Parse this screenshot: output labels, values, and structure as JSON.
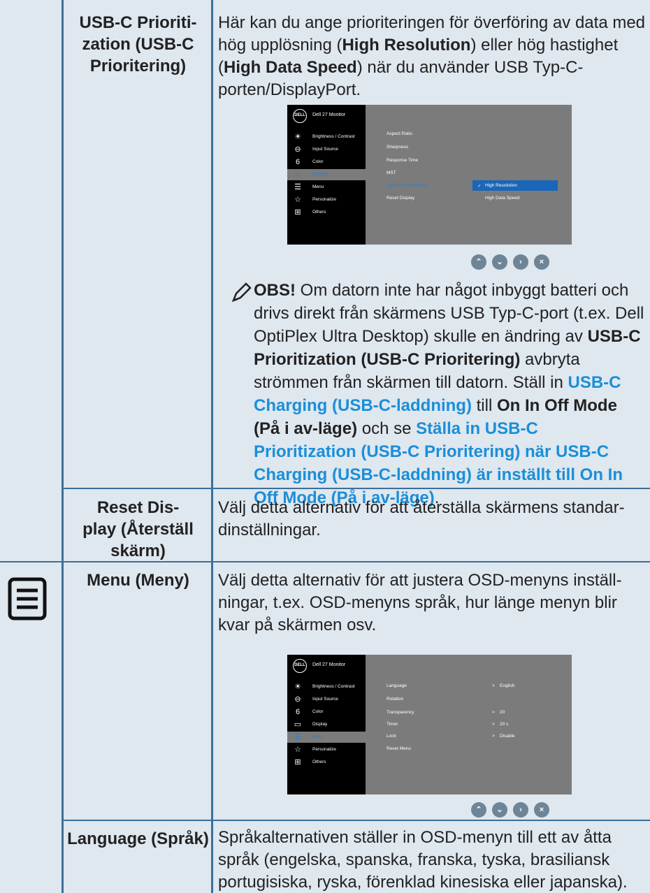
{
  "rows": {
    "usbc": {
      "label": "USB-C Prioriti-\nzation (USB-C Prioritering)",
      "desc_1": "Här kan du ange prioriteringen för överföring av data med hög upplösning (",
      "desc_b1": "High Resolution",
      "desc_2": ") eller hög hastighet (",
      "desc_b2": "High Data Speed",
      "desc_3": ") när du använder USB Typ-C-porten/DisplayPort."
    },
    "note": {
      "obs": "OBS!",
      "t1": " Om datorn inte har något inbyggt batteri och drivs direkt från skärmens USB Typ-C-port (t.ex. Dell OptiPlex Ultra Desktop) skulle en ändring av ",
      "b1": "USB-C Prioritization (USB-C Prioritering)",
      "t2": " avbryta strömmen från skärmen till datorn. Ställ in ",
      "l1": "USB-C Charging (USB-C-laddning)",
      "t3": " till ",
      "b2": "On In Off Mode (På i av-läge)",
      "t4": " och se ",
      "l2": "Ställa in USB-C Prioritization (USB-C Prioritering) när USB-C Charging (USB-C-laddning) är inställt till On In Off Mode (På i av-läge)",
      "t5": "."
    },
    "reset": {
      "label": "Reset Dis-\nplay (Återställ skärm)",
      "desc": "Välj detta alternativ för att återställa skärmens standar-dinställningar."
    },
    "menu": {
      "label": "Menu (Meny)",
      "desc": "Välj detta alternativ för att justera OSD-menyns inställ-ningar, t.ex. OSD-menyns språk, hur länge menyn blir kvar på skärmen osv."
    },
    "language": {
      "label": "Language (Språk)",
      "desc": "Språkalternativen ställer in OSD-menyn till ett av åtta språk (engelska, spanska, franska, tyska, brasiliansk portugisiska, ryska, förenklad kinesiska eller japanska)."
    }
  },
  "osd": {
    "logo": "DELL",
    "title": "Dell 27 Monitor",
    "sidebar": [
      "Brightness / Contrast",
      "Input Source",
      "Color",
      "Display",
      "Menu",
      "Personalize",
      "Others"
    ],
    "display_options": [
      "Aspect Ratio",
      "Sharpness",
      "Response Time",
      "MST",
      "USB-C Prioritization",
      "Reset Display"
    ],
    "display_values": [
      "High Resolution",
      "High Data Speed"
    ],
    "menu_options": [
      "Language",
      "Rotation",
      "Transparency",
      "Timer",
      "Lock",
      "Reset Menu"
    ],
    "menu_values": [
      "English",
      "20",
      "20 s",
      "Disable"
    ]
  },
  "icons": {
    "nav": [
      "up-icon",
      "down-icon",
      "right-icon",
      "close-icon"
    ],
    "colors": {
      "accent": "#1a8fd8",
      "rule": "#3c6f9a",
      "bg": "#dfe7ef"
    }
  }
}
